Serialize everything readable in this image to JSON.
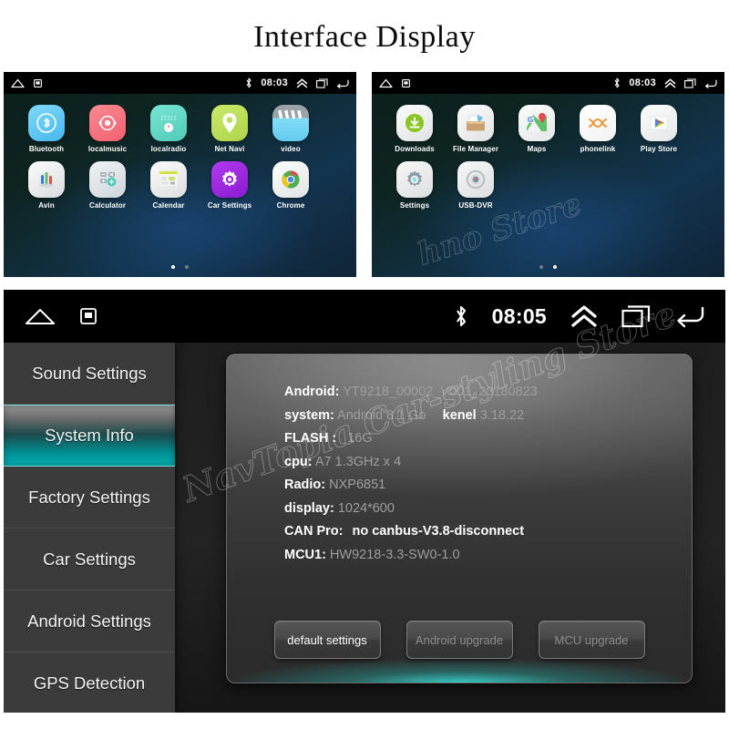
{
  "page": {
    "title": "Interface Display",
    "watermark_top": "hno Store",
    "watermark_bottom": "NavTopia Car-styling Store"
  },
  "screens": [
    {
      "name": "home-screen-page-1",
      "statusbar": {
        "time": "08:03",
        "left_icons": [
          "home-icon",
          "screenshot-icon"
        ],
        "right_icons": [
          "bluetooth-icon",
          "chevron-up-icon",
          "recents-icon",
          "back-icon"
        ]
      },
      "apps_row1": [
        {
          "label": "Bluetooth",
          "icon": "bluetooth-app-icon",
          "color": "#5BC8F5"
        },
        {
          "label": "localmusic",
          "icon": "music-app-icon",
          "color": "#F5737F"
        },
        {
          "label": "localradio",
          "icon": "radio-app-icon",
          "color": "#5FD8C5"
        },
        {
          "label": "Net Navi",
          "icon": "navigation-app-icon",
          "color": "#BDDE5A"
        },
        {
          "label": "video",
          "icon": "video-app-icon",
          "color": "#7FD8F2"
        }
      ],
      "apps_row2": [
        {
          "label": "Avin",
          "icon": "avin-app-icon",
          "color": "#E9E9E9"
        },
        {
          "label": "Calculator",
          "icon": "calculator-app-icon",
          "color": "#D9DEE2"
        },
        {
          "label": "Calendar",
          "icon": "calendar-app-icon",
          "color": "#ECECEC"
        },
        {
          "label": "Car Settings",
          "icon": "car-settings-app-icon",
          "color": "#9C27E0"
        },
        {
          "label": "Chrome",
          "icon": "chrome-app-icon",
          "color": "#F2F2F2"
        }
      ],
      "page_dots": {
        "count": 2,
        "active": 0
      }
    },
    {
      "name": "home-screen-page-2",
      "statusbar": {
        "time": "08:03",
        "left_icons": [
          "home-icon",
          "screenshot-icon"
        ],
        "right_icons": [
          "bluetooth-icon",
          "chevron-up-icon",
          "recents-icon",
          "back-icon"
        ]
      },
      "apps_row1": [
        {
          "label": "Downloads",
          "icon": "downloads-app-icon",
          "color": "#EDEDED"
        },
        {
          "label": "File Manager",
          "icon": "file-manager-app-icon",
          "color": "#EFEFEF"
        },
        {
          "label": "Maps",
          "icon": "maps-app-icon",
          "color": "#F4F4F4"
        },
        {
          "label": "phonelink",
          "icon": "phonelink-app-icon",
          "color": "#FAFAFA"
        },
        {
          "label": "Play Store",
          "icon": "play-store-app-icon",
          "color": "#F2F2F2"
        }
      ],
      "apps_row2": [
        {
          "label": "Settings",
          "icon": "settings-app-icon",
          "color": "#E4E4E4"
        },
        {
          "label": "USB-DVR",
          "icon": "usb-dvr-app-icon",
          "color": "#E4E4E4"
        }
      ],
      "page_dots": {
        "count": 2,
        "active": 1
      }
    }
  ],
  "settings_screen": {
    "statusbar": {
      "time": "08:05",
      "left_icons": [
        "home-icon",
        "screenshot-icon"
      ],
      "right_icons": [
        "bluetooth-icon",
        "chevron-up-icon",
        "recents-icon",
        "back-icon"
      ]
    },
    "sidebar": {
      "items": [
        {
          "label": "Sound Settings",
          "selected": false
        },
        {
          "label": "System Info",
          "selected": true
        },
        {
          "label": "Factory Settings",
          "selected": false
        },
        {
          "label": "Car Settings",
          "selected": false
        },
        {
          "label": "Android Settings",
          "selected": false
        },
        {
          "label": "GPS Detection",
          "selected": false
        }
      ],
      "accent_color": "#03b2b4"
    },
    "system_info": {
      "rows": [
        {
          "key": "Android:",
          "value": "YT9218_00002_V001_20180823"
        },
        {
          "key": "system:",
          "value": "Android 8.1 Go",
          "key2": "kenel",
          "value2": "3.18.22"
        },
        {
          "key": "FLASH :",
          "value": "16G"
        },
        {
          "key": "cpu:",
          "value": "A7 1.3GHz x 4"
        },
        {
          "key": "Radio:",
          "value": "NXP6851"
        },
        {
          "key": "display:",
          "value": "1024*600"
        },
        {
          "key": "CAN Pro:",
          "value": "no canbus-V3.8-disconnect"
        },
        {
          "key": "MCU1:",
          "value": "HW9218-3.3-SW0-1.0"
        }
      ],
      "buttons": [
        {
          "label": "default settings",
          "disabled": false
        },
        {
          "label": "Android upgrade",
          "disabled": true
        },
        {
          "label": "MCU upgrade",
          "disabled": true
        }
      ]
    }
  }
}
